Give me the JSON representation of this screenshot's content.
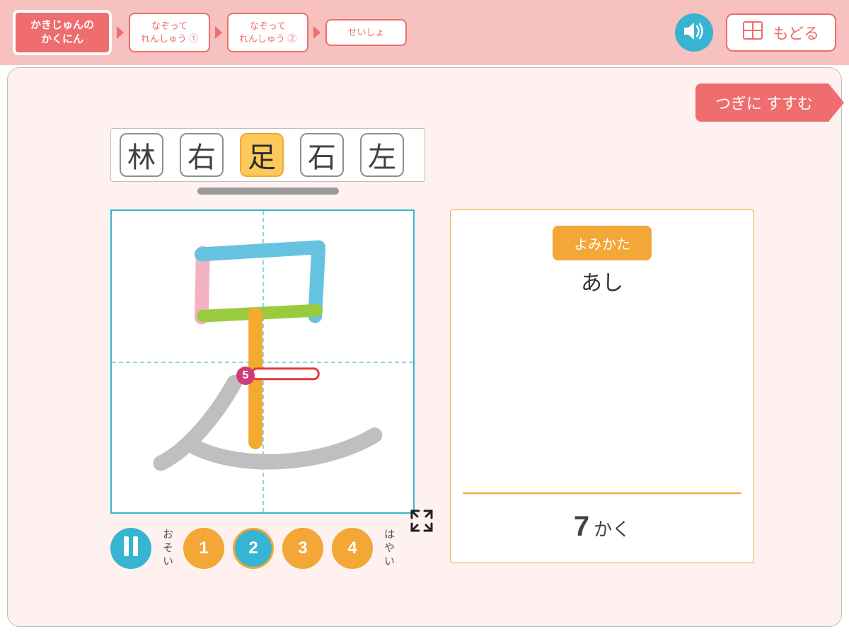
{
  "nav": {
    "tabs": [
      {
        "line1": "かきじゅんの",
        "line2": "かくにん"
      },
      {
        "line1": "なぞって",
        "line2": "れんしゅう ①"
      },
      {
        "line1": "なぞって",
        "line2": "れんしゅう ②"
      },
      {
        "line1": "せいしょ",
        "line2": ""
      }
    ],
    "active_index": 0,
    "back_label": "もどる"
  },
  "next_button_label": "つぎに すすむ",
  "kanji_choices": [
    "林",
    "右",
    "足",
    "石",
    "左"
  ],
  "selected_kanji_index": 2,
  "current_stroke_indicator": "5",
  "playback": {
    "slow_label": "おそい",
    "fast_label": "はやい",
    "speeds": [
      "1",
      "2",
      "3",
      "4"
    ],
    "selected_speed_index": 1
  },
  "info": {
    "reading_button_label": "よみかた",
    "reading_text": "あし",
    "stroke_count_number": "7",
    "stroke_count_suffix": "かく"
  },
  "colors": {
    "accent_red": "#ef6d6e",
    "accent_orange": "#f2a736",
    "accent_cyan": "#37b4d2",
    "pink_bg": "#f6c1be"
  }
}
